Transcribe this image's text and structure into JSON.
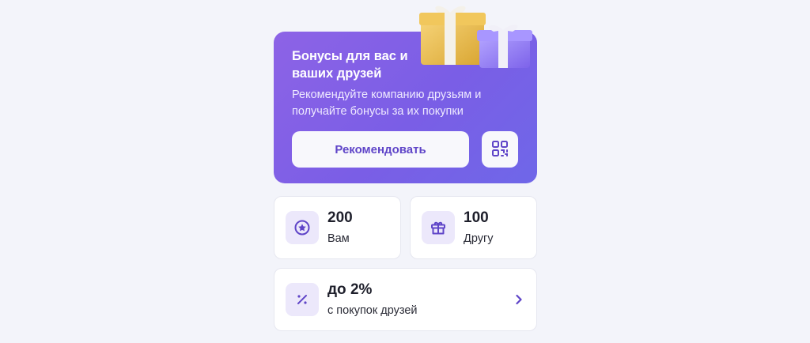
{
  "promo": {
    "title": "Бонусы для вас и ваших друзей",
    "description": "Рекомендуйте компанию друзьям и получайте бонусы за их покупки",
    "recommend_label": "Рекомендовать",
    "qr_icon": "qr-code-icon",
    "illustration": "gift-boxes-illustration"
  },
  "stats": [
    {
      "value": "200",
      "label": "Вам",
      "icon": "star-badge-icon"
    },
    {
      "value": "100",
      "label": "Другу",
      "icon": "gift-icon"
    }
  ],
  "bonus": {
    "value": "до 2%",
    "label": "с покупок друзей",
    "icon": "percent-icon",
    "arrow_icon": "chevron-right-icon"
  },
  "colors": {
    "background": "#f3f4fa",
    "promo_gradient_start": "#8d63e6",
    "promo_gradient_end": "#6f67e8",
    "accent": "#5f45c8",
    "icon_tile": "#ece8fb"
  }
}
